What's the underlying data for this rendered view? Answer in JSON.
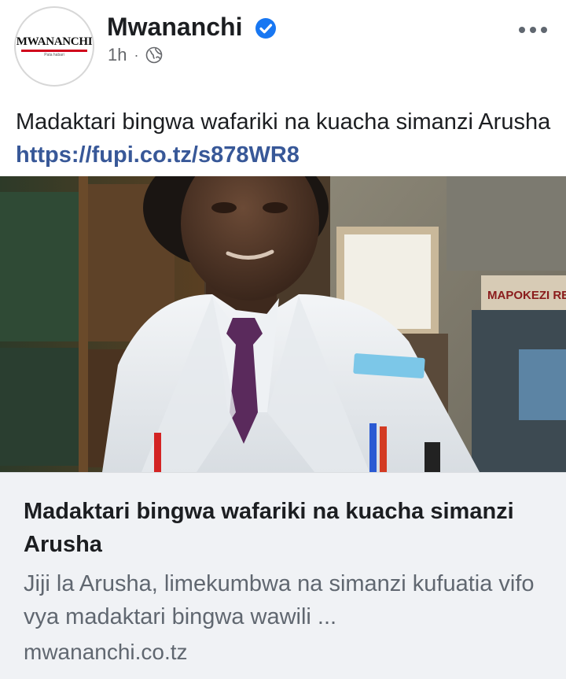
{
  "post": {
    "page_name": "Mwananchi",
    "verified": true,
    "time": "1h",
    "separator": "·",
    "privacy_icon": "globe-icon",
    "more_icon": "more-options-icon",
    "text": "Madaktari bingwa wafariki na kuacha simanzi Arusha",
    "link_text": "https://fupi.co.tz/s878WR8"
  },
  "avatar": {
    "logo_text": "MWANANCHI",
    "logo_tag": "Pata habari"
  },
  "link_preview": {
    "title": "Madaktari bingwa wafariki na kuacha simanzi Arusha",
    "description": "Jiji la Arusha, limekumbwa na simanzi kufuatia vifo vya madaktari bingwa wawili ...",
    "domain": "mwananchi.co.tz",
    "photo_sign_text": "MAPOKEZI  RECE"
  },
  "colors": {
    "link": "#385898",
    "verified_badge": "#1877f2",
    "muted": "#65676b",
    "card_bg": "#f0f2f5"
  }
}
